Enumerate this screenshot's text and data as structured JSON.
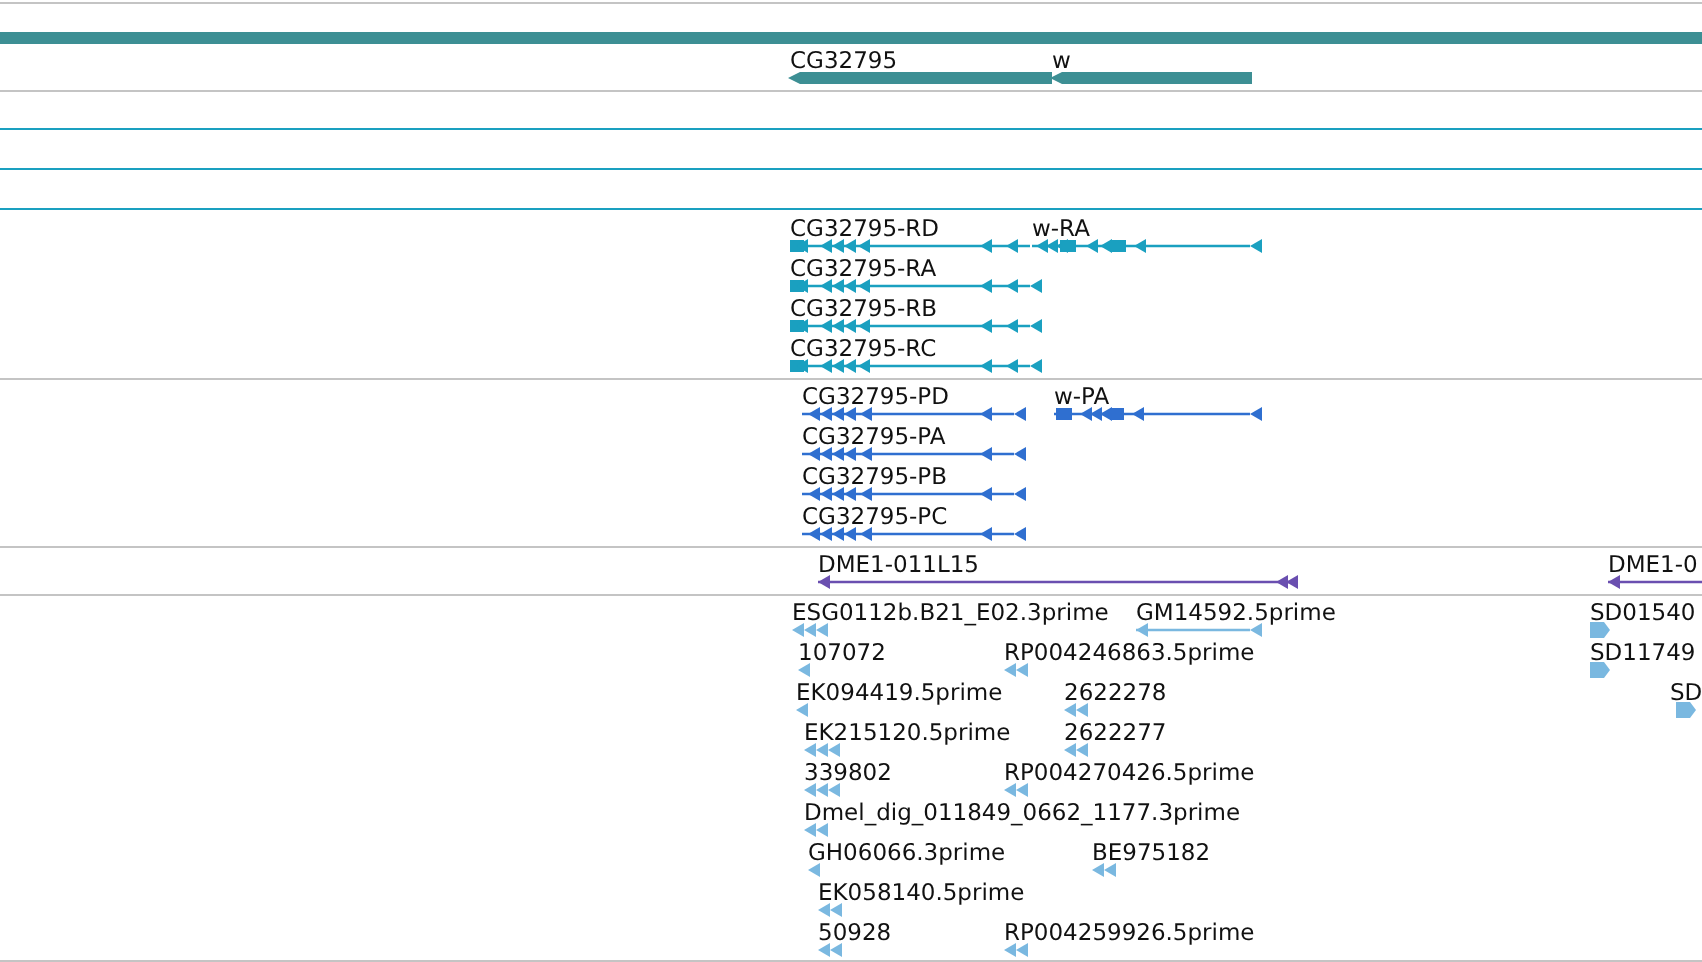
{
  "tracks": [
    {
      "kind": "gene",
      "features": [
        {
          "label": "CG32795",
          "forward": false
        },
        {
          "label": "w",
          "forward": false
        }
      ]
    },
    {
      "kind": "transcript",
      "features": [
        {
          "label": "CG32795-RD",
          "forward": false
        },
        {
          "label": "w-RA",
          "forward": false
        },
        {
          "label": "CG32795-RA",
          "forward": false
        },
        {
          "label": "CG32795-RB",
          "forward": false
        },
        {
          "label": "CG32795-RC",
          "forward": false
        }
      ]
    },
    {
      "kind": "protein",
      "features": [
        {
          "label": "CG32795-PD",
          "forward": false
        },
        {
          "label": "w-PA",
          "forward": false
        },
        {
          "label": "CG32795-PA",
          "forward": false
        },
        {
          "label": "CG32795-PB",
          "forward": false
        },
        {
          "label": "CG32795-PC",
          "forward": false
        }
      ]
    },
    {
      "kind": "clone",
      "features": [
        {
          "label": "DME1-011L15",
          "forward": false
        },
        {
          "label": "DME1-0",
          "forward": false
        }
      ]
    },
    {
      "kind": "est",
      "features": [
        {
          "label": "ESG0112b.B21_E02.3prime",
          "forward": false
        },
        {
          "label": "GM14592.5prime",
          "forward": false
        },
        {
          "label": "107072",
          "forward": false
        },
        {
          "label": "RP004246863.5prime",
          "forward": false
        },
        {
          "label": "EK094419.5prime",
          "forward": false
        },
        {
          "label": "2622278",
          "forward": false
        },
        {
          "label": "EK215120.5prime",
          "forward": false
        },
        {
          "label": "2622277",
          "forward": false
        },
        {
          "label": "339802",
          "forward": false
        },
        {
          "label": "RP004270426.5prime",
          "forward": false
        },
        {
          "label": "Dmel_dig_011849_0662_1177.3prime",
          "forward": false
        },
        {
          "label": "GH06066.3prime",
          "forward": false
        },
        {
          "label": "BE975182",
          "forward": false
        },
        {
          "label": "EK058140.5prime",
          "forward": false
        },
        {
          "label": "50928",
          "forward": false
        },
        {
          "label": "RP004259926.5prime",
          "forward": false
        },
        {
          "label": "SD01540",
          "forward": true
        },
        {
          "label": "SD11749",
          "forward": true
        },
        {
          "label": "SD",
          "forward": true
        }
      ]
    }
  ]
}
